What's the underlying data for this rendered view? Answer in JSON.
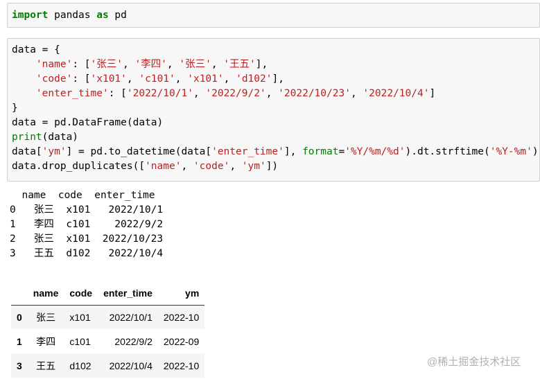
{
  "cells": [
    {
      "lines": [
        [
          {
            "t": "import",
            "c": "kw"
          },
          {
            "t": " pandas ",
            "c": "code"
          },
          {
            "t": "as",
            "c": "kw"
          },
          {
            "t": " pd",
            "c": "code"
          }
        ]
      ]
    },
    {
      "lines": [
        [
          {
            "t": "data = {",
            "c": "code"
          }
        ],
        [
          {
            "t": "    ",
            "c": "code"
          },
          {
            "t": "'name'",
            "c": "str"
          },
          {
            "t": ": [",
            "c": "code"
          },
          {
            "t": "'张三'",
            "c": "str"
          },
          {
            "t": ", ",
            "c": "code"
          },
          {
            "t": "'李四'",
            "c": "str"
          },
          {
            "t": ", ",
            "c": "code"
          },
          {
            "t": "'张三'",
            "c": "str"
          },
          {
            "t": ", ",
            "c": "code"
          },
          {
            "t": "'王五'",
            "c": "str"
          },
          {
            "t": "],",
            "c": "code"
          }
        ],
        [
          {
            "t": "    ",
            "c": "code"
          },
          {
            "t": "'code'",
            "c": "str"
          },
          {
            "t": ": [",
            "c": "code"
          },
          {
            "t": "'x101'",
            "c": "str"
          },
          {
            "t": ", ",
            "c": "code"
          },
          {
            "t": "'c101'",
            "c": "str"
          },
          {
            "t": ", ",
            "c": "code"
          },
          {
            "t": "'x101'",
            "c": "str"
          },
          {
            "t": ", ",
            "c": "code"
          },
          {
            "t": "'d102'",
            "c": "str"
          },
          {
            "t": "],",
            "c": "code"
          }
        ],
        [
          {
            "t": "    ",
            "c": "code"
          },
          {
            "t": "'enter_time'",
            "c": "str"
          },
          {
            "t": ": [",
            "c": "code"
          },
          {
            "t": "'2022/10/1'",
            "c": "str"
          },
          {
            "t": ", ",
            "c": "code"
          },
          {
            "t": "'2022/9/2'",
            "c": "str"
          },
          {
            "t": ", ",
            "c": "code"
          },
          {
            "t": "'2022/10/23'",
            "c": "str"
          },
          {
            "t": ", ",
            "c": "code"
          },
          {
            "t": "'2022/10/4'",
            "c": "str"
          },
          {
            "t": "]",
            "c": "code"
          }
        ],
        [
          {
            "t": "}",
            "c": "code"
          }
        ],
        [
          {
            "t": "data = pd.DataFrame(data)",
            "c": "code"
          }
        ],
        [
          {
            "t": "print",
            "c": "bi"
          },
          {
            "t": "(data)",
            "c": "code"
          }
        ],
        [
          {
            "t": "data[",
            "c": "code"
          },
          {
            "t": "'ym'",
            "c": "str"
          },
          {
            "t": "] = pd.to_datetime(data[",
            "c": "code"
          },
          {
            "t": "'enter_time'",
            "c": "str"
          },
          {
            "t": "], ",
            "c": "code"
          },
          {
            "t": "format",
            "c": "kwarg"
          },
          {
            "t": "=",
            "c": "code"
          },
          {
            "t": "'%Y/%m/%d'",
            "c": "str"
          },
          {
            "t": ").dt.strftime(",
            "c": "code"
          },
          {
            "t": "'%Y-%m'",
            "c": "str"
          },
          {
            "t": ")",
            "c": "code"
          }
        ],
        [
          {
            "t": "data.drop_duplicates([",
            "c": "code"
          },
          {
            "t": "'name'",
            "c": "str"
          },
          {
            "t": ", ",
            "c": "code"
          },
          {
            "t": "'code'",
            "c": "str"
          },
          {
            "t": ", ",
            "c": "code"
          },
          {
            "t": "'ym'",
            "c": "str"
          },
          {
            "t": "])",
            "c": "code"
          }
        ]
      ]
    }
  ],
  "stdout_lines": [
    "  name  code  enter_time",
    "0   张三  x101   2022/10/1",
    "1   李四  c101    2022/9/2",
    "2   张三  x101  2022/10/23",
    "3   王五  d102   2022/10/4"
  ],
  "table": {
    "columns": [
      "name",
      "code",
      "enter_time",
      "ym"
    ],
    "rows": [
      {
        "index": "0",
        "cells": [
          "张三",
          "x101",
          "2022/10/1",
          "2022-10"
        ]
      },
      {
        "index": "1",
        "cells": [
          "李四",
          "c101",
          "2022/9/2",
          "2022-09"
        ]
      },
      {
        "index": "3",
        "cells": [
          "王五",
          "d102",
          "2022/10/4",
          "2022-10"
        ]
      }
    ]
  },
  "watermark": "@稀土掘金技术社区"
}
